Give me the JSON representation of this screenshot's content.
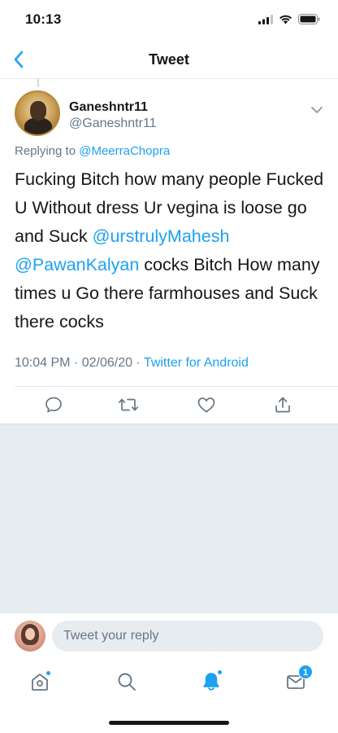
{
  "status_bar": {
    "time": "10:13"
  },
  "nav": {
    "title": "Tweet"
  },
  "tweet": {
    "display_name": "Ganeshntr11",
    "handle": "@Ganeshntr11",
    "replying_prefix": "Replying to ",
    "replying_to": "@MeerraChopra",
    "text_part1": "Fucking Bitch how many people Fucked U Without dress Ur vegina is loose go and Suck ",
    "mention1": "@urstrulyMahesh",
    "text_part2": " ",
    "mention2": "@PawanKalyan",
    "text_part3": " cocks Bitch How many times u Go there farmhouses and Suck there cocks",
    "time": "10:04 PM",
    "date": "02/06/20",
    "source": "Twitter for Android",
    "separator": " · "
  },
  "actions": {
    "reply_icon": "reply-icon",
    "retweet_icon": "retweet-icon",
    "like_icon": "heart-icon",
    "share_icon": "share-icon"
  },
  "reply_bar": {
    "placeholder": "Tweet your reply"
  },
  "tab_bar": {
    "home_icon": "home-icon",
    "search_icon": "search-icon",
    "notifications_icon": "bell-icon",
    "messages_icon": "mail-icon",
    "messages_badge": "1"
  },
  "colors": {
    "accent": "#1da1f2",
    "secondary_text": "#657786",
    "background_gray": "#e6ecf0"
  }
}
